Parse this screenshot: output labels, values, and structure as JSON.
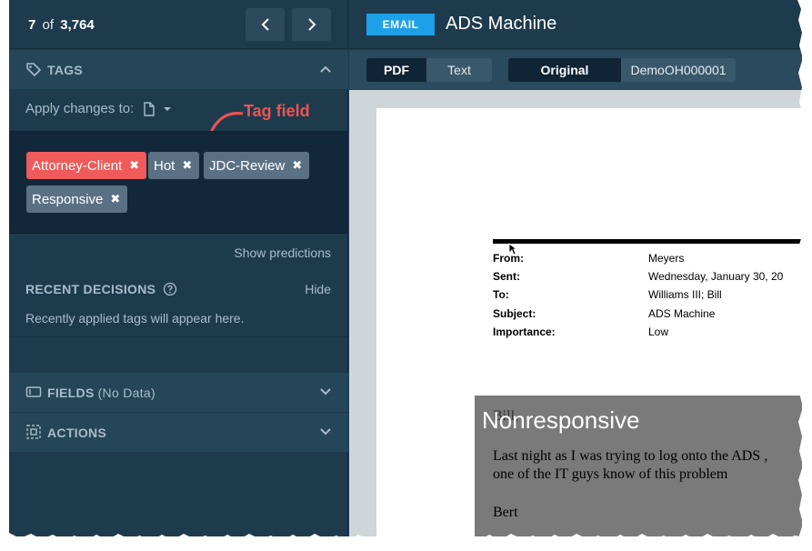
{
  "pager": {
    "current": "7",
    "of": "of",
    "total": "3,764"
  },
  "tags_section": {
    "title": "TAGS"
  },
  "apply": {
    "label": "Apply changes to:"
  },
  "callout": {
    "label": "Tag field"
  },
  "tags": [
    {
      "label": "Attorney-Client",
      "color": "#ef5a5a"
    },
    {
      "label": "Hot",
      "color": "#5a7184"
    },
    {
      "label": "JDC-Review",
      "color": "#5a7184"
    },
    {
      "label": "Responsive",
      "color": "#5a7184"
    }
  ],
  "show_predictions": "Show predictions",
  "recent": {
    "title": "RECENT DECISIONS",
    "hide": "Hide",
    "note": "Recently applied tags will appear here."
  },
  "fields": {
    "title": "FIELDS",
    "sub": "(No Data)"
  },
  "actions": {
    "title": "ACTIONS"
  },
  "doc": {
    "type_badge": "EMAIL",
    "title": "ADS Machine"
  },
  "view_modes": {
    "pdf": "PDF",
    "text": "Text",
    "original": "Original",
    "doc_id": "DemoOH000001"
  },
  "email_header": [
    {
      "key": "From:",
      "value": "Meyers"
    },
    {
      "key": "Sent:",
      "value": "Wednesday, January 30, 20"
    },
    {
      "key": "To:",
      "value": "Williams III; Bill"
    },
    {
      "key": "Subject:",
      "value": "ADS Machine"
    },
    {
      "key": "Importance:",
      "value": "Low"
    }
  ],
  "redaction": {
    "label": "Nonresponsive"
  },
  "body": {
    "greeting": "Bill,",
    "line1": "Last night as I was trying to log onto the ADS ,",
    "line2": "one of the IT guys know of this problem",
    "signoff": "Bert"
  },
  "colors": {
    "panel": "#1e3b4e",
    "section": "#254558",
    "accent": "#1ea0e8",
    "tag_red": "#ef5a5a"
  }
}
